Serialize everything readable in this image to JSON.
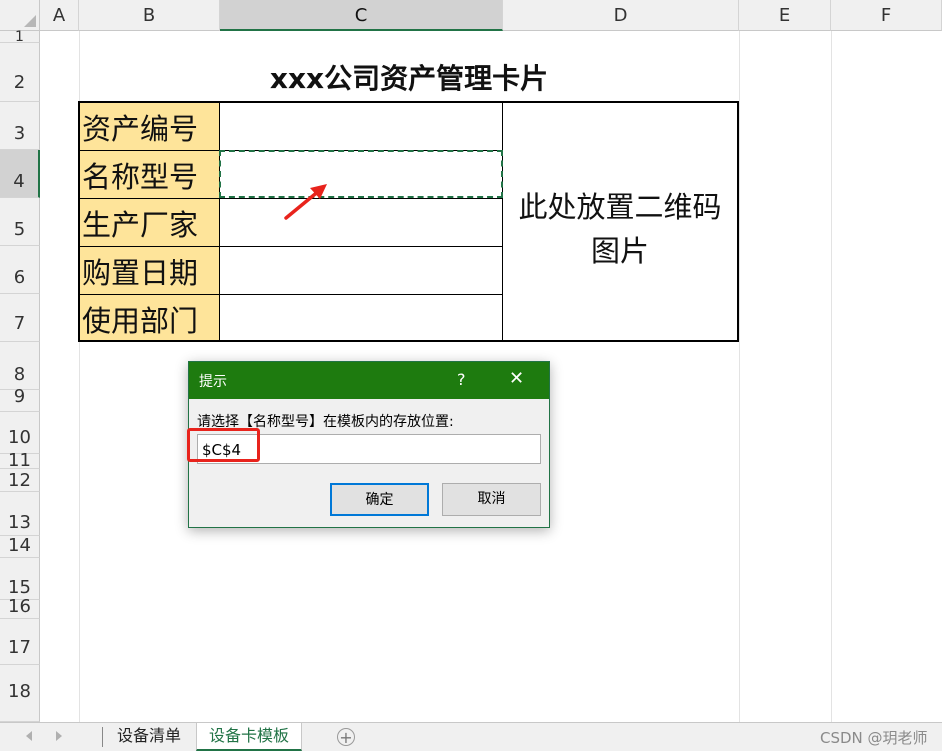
{
  "grid": {
    "columns": [
      "A",
      "B",
      "C",
      "D",
      "E",
      "F"
    ],
    "rows": [
      "1",
      "2",
      "3",
      "4",
      "5",
      "6",
      "7",
      "8",
      "9",
      "10",
      "11",
      "12",
      "13",
      "14",
      "15",
      "16",
      "17",
      "18"
    ]
  },
  "card": {
    "title": "xxx公司资产管理卡片",
    "labels": [
      "资产编号",
      "名称型号",
      "生产厂家",
      "购置日期",
      "使用部门"
    ],
    "qr_placeholder_line1": "此处放置二维码",
    "qr_placeholder_line2": "图片"
  },
  "dialog": {
    "title": "提示",
    "help": "?",
    "close": "✕",
    "prompt": "请选择【名称型号】在模板内的存放位置:",
    "input_value": "$C$4",
    "ok_label": "确定",
    "cancel_label": "取消"
  },
  "sheet_tabs": {
    "tabs": [
      "设备清单",
      "设备卡模板"
    ],
    "active": "设备卡模板",
    "add": "+"
  },
  "watermark": "CSDN @玥老师",
  "colors": {
    "accent": "#217346",
    "label_fill": "#fee49a",
    "highlight_red": "#e8231c"
  }
}
